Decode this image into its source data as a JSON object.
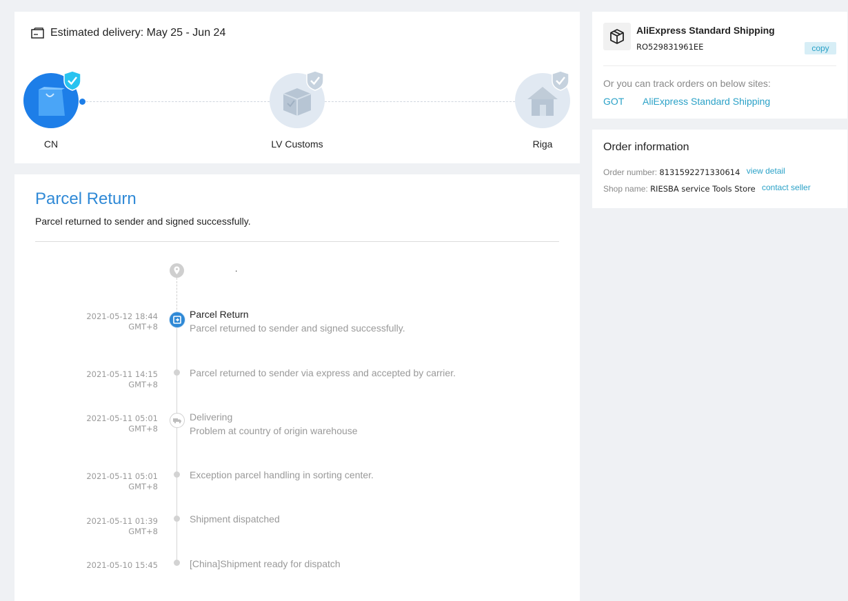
{
  "delivery": {
    "estimated": "Estimated delivery: May 25 - Jun 24",
    "nodes": [
      {
        "label": "CN",
        "status": "completed"
      },
      {
        "label": "LV Customs",
        "status": "pending"
      },
      {
        "label": "Riga",
        "status": "pending"
      }
    ]
  },
  "status": {
    "title": "Parcel Return",
    "subtitle": "Parcel returned to sender and signed successfully."
  },
  "timeline": {
    "top_text": ".",
    "events": [
      {
        "date": "2021-05-12 18:44",
        "tz": "GMT+8",
        "title": "Parcel Return",
        "detail": "Parcel returned to sender and signed successfully.",
        "icon": "return-icon"
      },
      {
        "date": "2021-05-11 14:15",
        "tz": "GMT+8",
        "title": "",
        "detail": "Parcel returned to sender via express and accepted by carrier.",
        "icon": "dot"
      },
      {
        "date": "2021-05-11 05:01",
        "tz": "GMT+8",
        "title": "Delivering",
        "detail": "Problem at country of origin warehouse",
        "icon": "truck-icon"
      },
      {
        "date": "2021-05-11 05:01",
        "tz": "GMT+8",
        "title": "",
        "detail": "Exception parcel handling in sorting center.",
        "icon": "dot"
      },
      {
        "date": "2021-05-11 01:39",
        "tz": "GMT+8",
        "title": "",
        "detail": "Shipment dispatched",
        "icon": "dot"
      },
      {
        "date": "2021-05-10 15:45",
        "tz": "",
        "title": "",
        "detail": "[China]Shipment ready for dispatch",
        "icon": "dot"
      }
    ]
  },
  "shipping": {
    "carrier": "AliExpress Standard Shipping",
    "tracking_number": "RO529831961EE",
    "copy_label": "copy",
    "note": "Or you can track orders on below sites:",
    "links": [
      "GOT",
      "AliExpress Standard Shipping"
    ]
  },
  "order": {
    "title": "Order information",
    "number_label": "Order number:",
    "number": "8131592271330614",
    "view_detail": "view detail",
    "shop_label": "Shop name:",
    "shop_name": "RIESBA service Tools Store",
    "contact_seller": "contact seller"
  },
  "colors": {
    "accent": "#2f89d6",
    "link": "#2aa1c7",
    "progress_blue": "#1d7ee8"
  }
}
